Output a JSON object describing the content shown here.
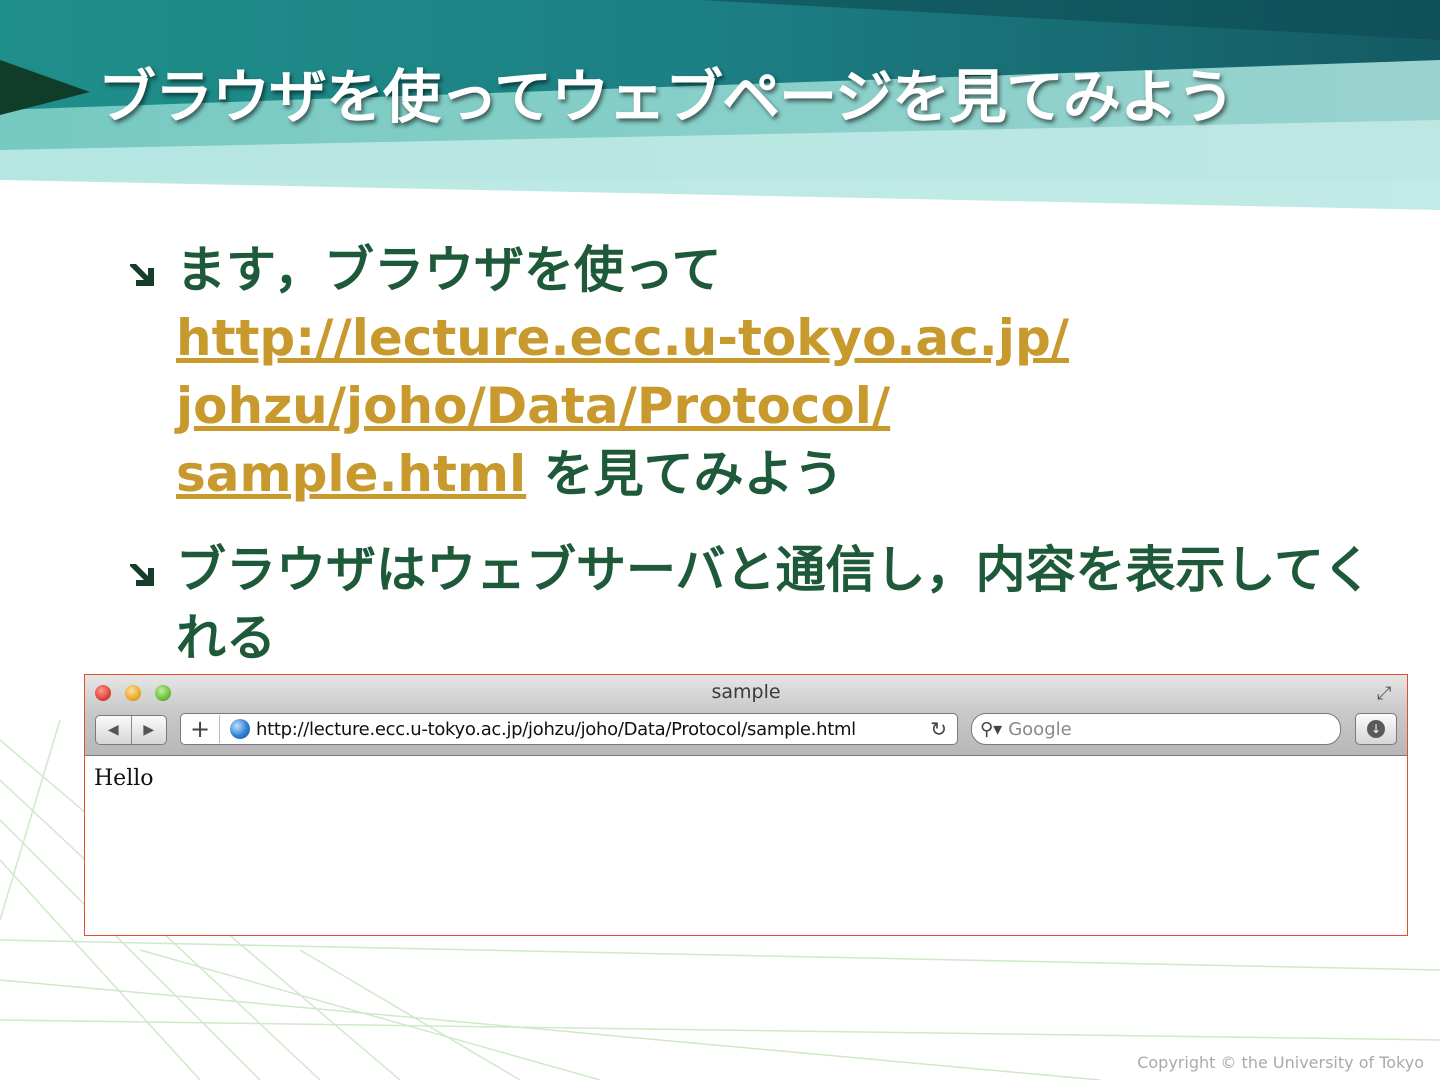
{
  "slide": {
    "title": "ブラウザを使ってウェブページを見てみよう",
    "bullets": [
      {
        "prefix": "ます，ブラウザを使って",
        "link_lines": [
          "http://lecture.ecc.u-tokyo.ac.jp/",
          "johzu/joho/Data/Protocol/",
          "sample.html"
        ],
        "suffix": "を見てみよう"
      },
      {
        "text": "ブラウザはウェブサーバと通信し，内容を表示してくれる"
      }
    ],
    "copyright": "Copyright © the University of Tokyo"
  },
  "browser": {
    "window_title": "sample",
    "url": "http://lecture.ecc.u-tokyo.ac.jp/johzu/joho/Data/Protocol/sample.html",
    "search_placeholder": "Google",
    "page_content": "Hello"
  },
  "colors": {
    "title_text": "#ffffff",
    "body_text": "#1e5a3a",
    "link": "#c89a2e",
    "browser_border": "#e0502a"
  },
  "icons": [
    "bullet-arrow-icon",
    "close-icon",
    "minimize-icon",
    "zoom-icon",
    "resize-icon",
    "back-icon",
    "forward-icon",
    "add-bookmark-icon",
    "globe-icon",
    "reload-icon",
    "search-icon",
    "download-icon"
  ]
}
